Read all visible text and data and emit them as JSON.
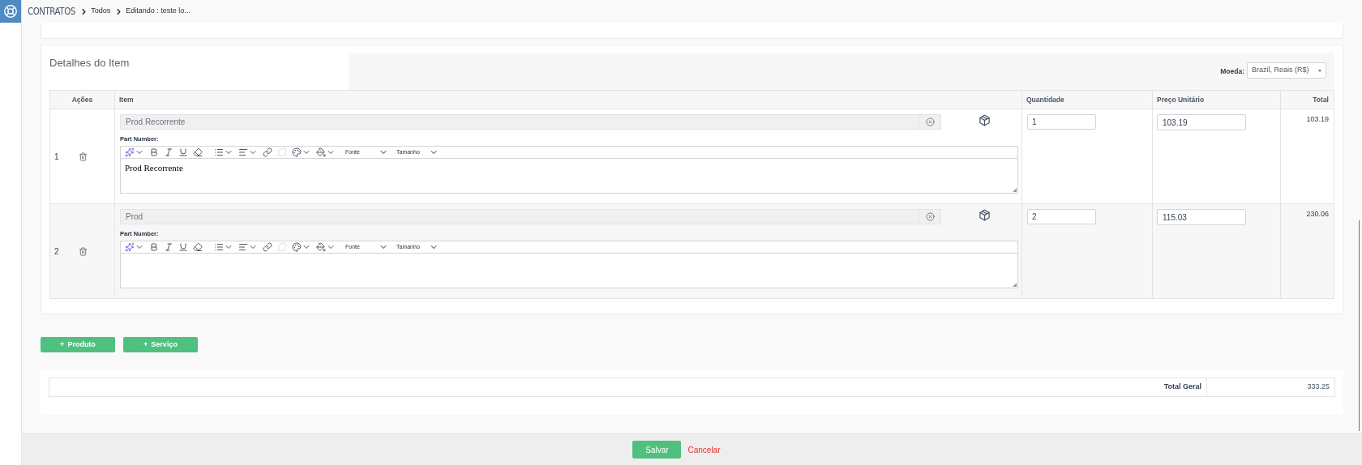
{
  "breadcrumb": {
    "module": "CONTRATOS",
    "items": [
      "Todos",
      "Editando : teste lo..."
    ]
  },
  "details": {
    "title": "Detalhes do Item",
    "currency_label": "Moeda:",
    "currency": "Brazil, Reais (R$)",
    "columns": [
      "Ações",
      "Item",
      "Quantidade",
      "Preço Unitário",
      "Total"
    ],
    "rows": [
      {
        "index": "1",
        "item": "Prod Recorrente",
        "part_number_label": "Part Number:",
        "font_label": "Fonte",
        "size_label": "Tamanho",
        "editor_text": "Prod Recorrente",
        "quantity": "1",
        "unit_price": "103.19",
        "total": "103.19"
      },
      {
        "index": "2",
        "item": "Prod",
        "part_number_label": "Part Number:",
        "font_label": "Fonte",
        "size_label": "Tamanho",
        "quantity": "2",
        "unit_price": "115.03",
        "total": "230.06"
      }
    ]
  },
  "add_buttons": [
    {
      "icon": "+",
      "label": "Produto"
    },
    {
      "icon": "+",
      "label": "Serviço"
    }
  ],
  "summary": {
    "label": "Total Geral",
    "value": "333.25"
  },
  "footer": {
    "save": "Salvar",
    "cancel": "Cancelar"
  }
}
